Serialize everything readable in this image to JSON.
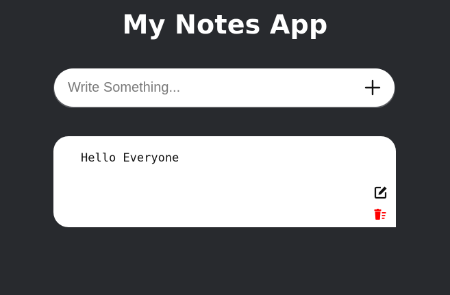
{
  "header": {
    "title": "My Notes App"
  },
  "composer": {
    "placeholder": "Write Something...",
    "value": "",
    "add_icon": "plus-icon"
  },
  "notes": [
    {
      "text": "Hello Everyone",
      "edit_icon": "edit-icon",
      "delete_icon": "trash-icon"
    }
  ],
  "colors": {
    "background": "#282a2e",
    "surface": "#ffffff",
    "title_text": "#ffffff",
    "note_text": "#111111",
    "delete_accent": "#ff0000",
    "edit_icon": "#111111"
  }
}
